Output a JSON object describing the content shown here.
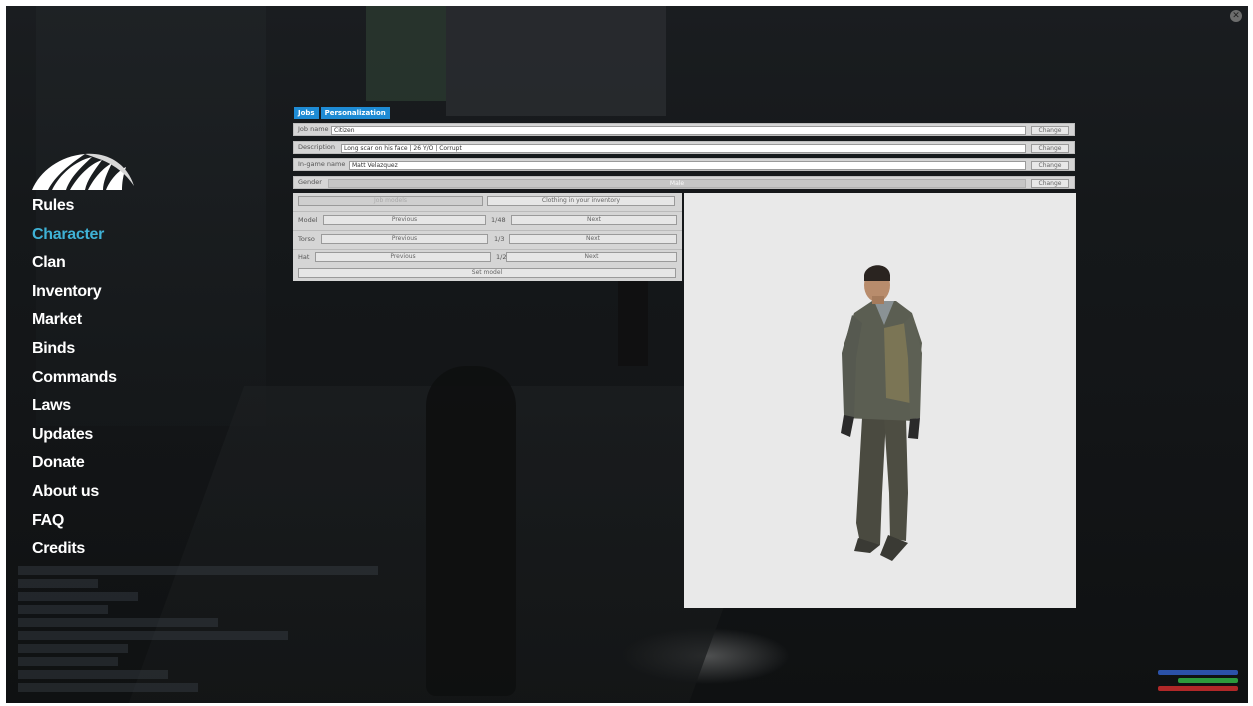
{
  "menu": {
    "items": [
      "Rules",
      "Character",
      "Clan",
      "Inventory",
      "Market",
      "Binds",
      "Commands",
      "Laws",
      "Updates",
      "Donate",
      "About us",
      "FAQ",
      "Credits"
    ],
    "active": "Character"
  },
  "tabs": [
    "Jobs",
    "Personalization"
  ],
  "form": {
    "job_name": {
      "label": "Job name",
      "value": "Citizen",
      "button": "Change"
    },
    "description": {
      "label": "Description",
      "value": "Long scar on his face | 26 Y/O | Corrupt",
      "button": "Change"
    },
    "ingame_name": {
      "label": "In-game name",
      "value": "Matt Velazquez",
      "button": "Change"
    },
    "gender": {
      "label": "Gender",
      "value": "Male",
      "button": "Change"
    }
  },
  "models": {
    "job_models_button": "Job models",
    "clothing_button": "Clothing in your inventory",
    "model": {
      "label": "Model",
      "prev": "Previous",
      "counter": "1/48",
      "next": "Next"
    },
    "torso": {
      "label": "Torso",
      "prev": "Previous",
      "counter": "1/3",
      "next": "Next"
    },
    "hat": {
      "label": "Hat",
      "prev": "Previous",
      "counter": "1/2",
      "next": "Next"
    },
    "set_model": "Set model"
  },
  "colors": {
    "accent": "#3fb2d6",
    "tab": "#1e8bd4",
    "panel": "#d5d5d5",
    "preview_bg": "#e9e9e9"
  },
  "icons": {
    "close": "close-icon",
    "logo": "wing-logo",
    "character": "character-model-preview"
  }
}
